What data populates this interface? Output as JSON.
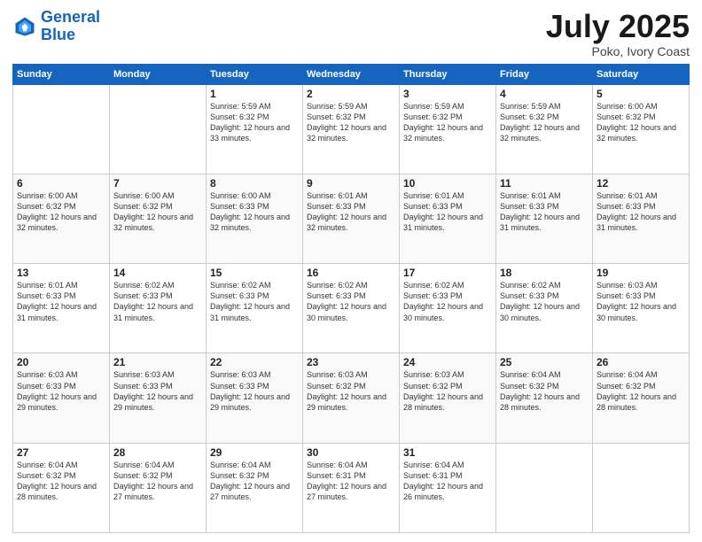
{
  "logo": {
    "line1": "General",
    "line2": "Blue"
  },
  "title": "July 2025",
  "location": "Poko, Ivory Coast",
  "weekdays": [
    "Sunday",
    "Monday",
    "Tuesday",
    "Wednesday",
    "Thursday",
    "Friday",
    "Saturday"
  ],
  "weeks": [
    [
      {
        "day": "",
        "sunrise": "",
        "sunset": "",
        "daylight": ""
      },
      {
        "day": "",
        "sunrise": "",
        "sunset": "",
        "daylight": ""
      },
      {
        "day": "1",
        "sunrise": "Sunrise: 5:59 AM",
        "sunset": "Sunset: 6:32 PM",
        "daylight": "Daylight: 12 hours and 33 minutes."
      },
      {
        "day": "2",
        "sunrise": "Sunrise: 5:59 AM",
        "sunset": "Sunset: 6:32 PM",
        "daylight": "Daylight: 12 hours and 32 minutes."
      },
      {
        "day": "3",
        "sunrise": "Sunrise: 5:59 AM",
        "sunset": "Sunset: 6:32 PM",
        "daylight": "Daylight: 12 hours and 32 minutes."
      },
      {
        "day": "4",
        "sunrise": "Sunrise: 5:59 AM",
        "sunset": "Sunset: 6:32 PM",
        "daylight": "Daylight: 12 hours and 32 minutes."
      },
      {
        "day": "5",
        "sunrise": "Sunrise: 6:00 AM",
        "sunset": "Sunset: 6:32 PM",
        "daylight": "Daylight: 12 hours and 32 minutes."
      }
    ],
    [
      {
        "day": "6",
        "sunrise": "Sunrise: 6:00 AM",
        "sunset": "Sunset: 6:32 PM",
        "daylight": "Daylight: 12 hours and 32 minutes."
      },
      {
        "day": "7",
        "sunrise": "Sunrise: 6:00 AM",
        "sunset": "Sunset: 6:32 PM",
        "daylight": "Daylight: 12 hours and 32 minutes."
      },
      {
        "day": "8",
        "sunrise": "Sunrise: 6:00 AM",
        "sunset": "Sunset: 6:33 PM",
        "daylight": "Daylight: 12 hours and 32 minutes."
      },
      {
        "day": "9",
        "sunrise": "Sunrise: 6:01 AM",
        "sunset": "Sunset: 6:33 PM",
        "daylight": "Daylight: 12 hours and 32 minutes."
      },
      {
        "day": "10",
        "sunrise": "Sunrise: 6:01 AM",
        "sunset": "Sunset: 6:33 PM",
        "daylight": "Daylight: 12 hours and 31 minutes."
      },
      {
        "day": "11",
        "sunrise": "Sunrise: 6:01 AM",
        "sunset": "Sunset: 6:33 PM",
        "daylight": "Daylight: 12 hours and 31 minutes."
      },
      {
        "day": "12",
        "sunrise": "Sunrise: 6:01 AM",
        "sunset": "Sunset: 6:33 PM",
        "daylight": "Daylight: 12 hours and 31 minutes."
      }
    ],
    [
      {
        "day": "13",
        "sunrise": "Sunrise: 6:01 AM",
        "sunset": "Sunset: 6:33 PM",
        "daylight": "Daylight: 12 hours and 31 minutes."
      },
      {
        "day": "14",
        "sunrise": "Sunrise: 6:02 AM",
        "sunset": "Sunset: 6:33 PM",
        "daylight": "Daylight: 12 hours and 31 minutes."
      },
      {
        "day": "15",
        "sunrise": "Sunrise: 6:02 AM",
        "sunset": "Sunset: 6:33 PM",
        "daylight": "Daylight: 12 hours and 31 minutes."
      },
      {
        "day": "16",
        "sunrise": "Sunrise: 6:02 AM",
        "sunset": "Sunset: 6:33 PM",
        "daylight": "Daylight: 12 hours and 30 minutes."
      },
      {
        "day": "17",
        "sunrise": "Sunrise: 6:02 AM",
        "sunset": "Sunset: 6:33 PM",
        "daylight": "Daylight: 12 hours and 30 minutes."
      },
      {
        "day": "18",
        "sunrise": "Sunrise: 6:02 AM",
        "sunset": "Sunset: 6:33 PM",
        "daylight": "Daylight: 12 hours and 30 minutes."
      },
      {
        "day": "19",
        "sunrise": "Sunrise: 6:03 AM",
        "sunset": "Sunset: 6:33 PM",
        "daylight": "Daylight: 12 hours and 30 minutes."
      }
    ],
    [
      {
        "day": "20",
        "sunrise": "Sunrise: 6:03 AM",
        "sunset": "Sunset: 6:33 PM",
        "daylight": "Daylight: 12 hours and 29 minutes."
      },
      {
        "day": "21",
        "sunrise": "Sunrise: 6:03 AM",
        "sunset": "Sunset: 6:33 PM",
        "daylight": "Daylight: 12 hours and 29 minutes."
      },
      {
        "day": "22",
        "sunrise": "Sunrise: 6:03 AM",
        "sunset": "Sunset: 6:33 PM",
        "daylight": "Daylight: 12 hours and 29 minutes."
      },
      {
        "day": "23",
        "sunrise": "Sunrise: 6:03 AM",
        "sunset": "Sunset: 6:32 PM",
        "daylight": "Daylight: 12 hours and 29 minutes."
      },
      {
        "day": "24",
        "sunrise": "Sunrise: 6:03 AM",
        "sunset": "Sunset: 6:32 PM",
        "daylight": "Daylight: 12 hours and 28 minutes."
      },
      {
        "day": "25",
        "sunrise": "Sunrise: 6:04 AM",
        "sunset": "Sunset: 6:32 PM",
        "daylight": "Daylight: 12 hours and 28 minutes."
      },
      {
        "day": "26",
        "sunrise": "Sunrise: 6:04 AM",
        "sunset": "Sunset: 6:32 PM",
        "daylight": "Daylight: 12 hours and 28 minutes."
      }
    ],
    [
      {
        "day": "27",
        "sunrise": "Sunrise: 6:04 AM",
        "sunset": "Sunset: 6:32 PM",
        "daylight": "Daylight: 12 hours and 28 minutes."
      },
      {
        "day": "28",
        "sunrise": "Sunrise: 6:04 AM",
        "sunset": "Sunset: 6:32 PM",
        "daylight": "Daylight: 12 hours and 27 minutes."
      },
      {
        "day": "29",
        "sunrise": "Sunrise: 6:04 AM",
        "sunset": "Sunset: 6:32 PM",
        "daylight": "Daylight: 12 hours and 27 minutes."
      },
      {
        "day": "30",
        "sunrise": "Sunrise: 6:04 AM",
        "sunset": "Sunset: 6:31 PM",
        "daylight": "Daylight: 12 hours and 27 minutes."
      },
      {
        "day": "31",
        "sunrise": "Sunrise: 6:04 AM",
        "sunset": "Sunset: 6:31 PM",
        "daylight": "Daylight: 12 hours and 26 minutes."
      },
      {
        "day": "",
        "sunrise": "",
        "sunset": "",
        "daylight": ""
      },
      {
        "day": "",
        "sunrise": "",
        "sunset": "",
        "daylight": ""
      }
    ]
  ]
}
